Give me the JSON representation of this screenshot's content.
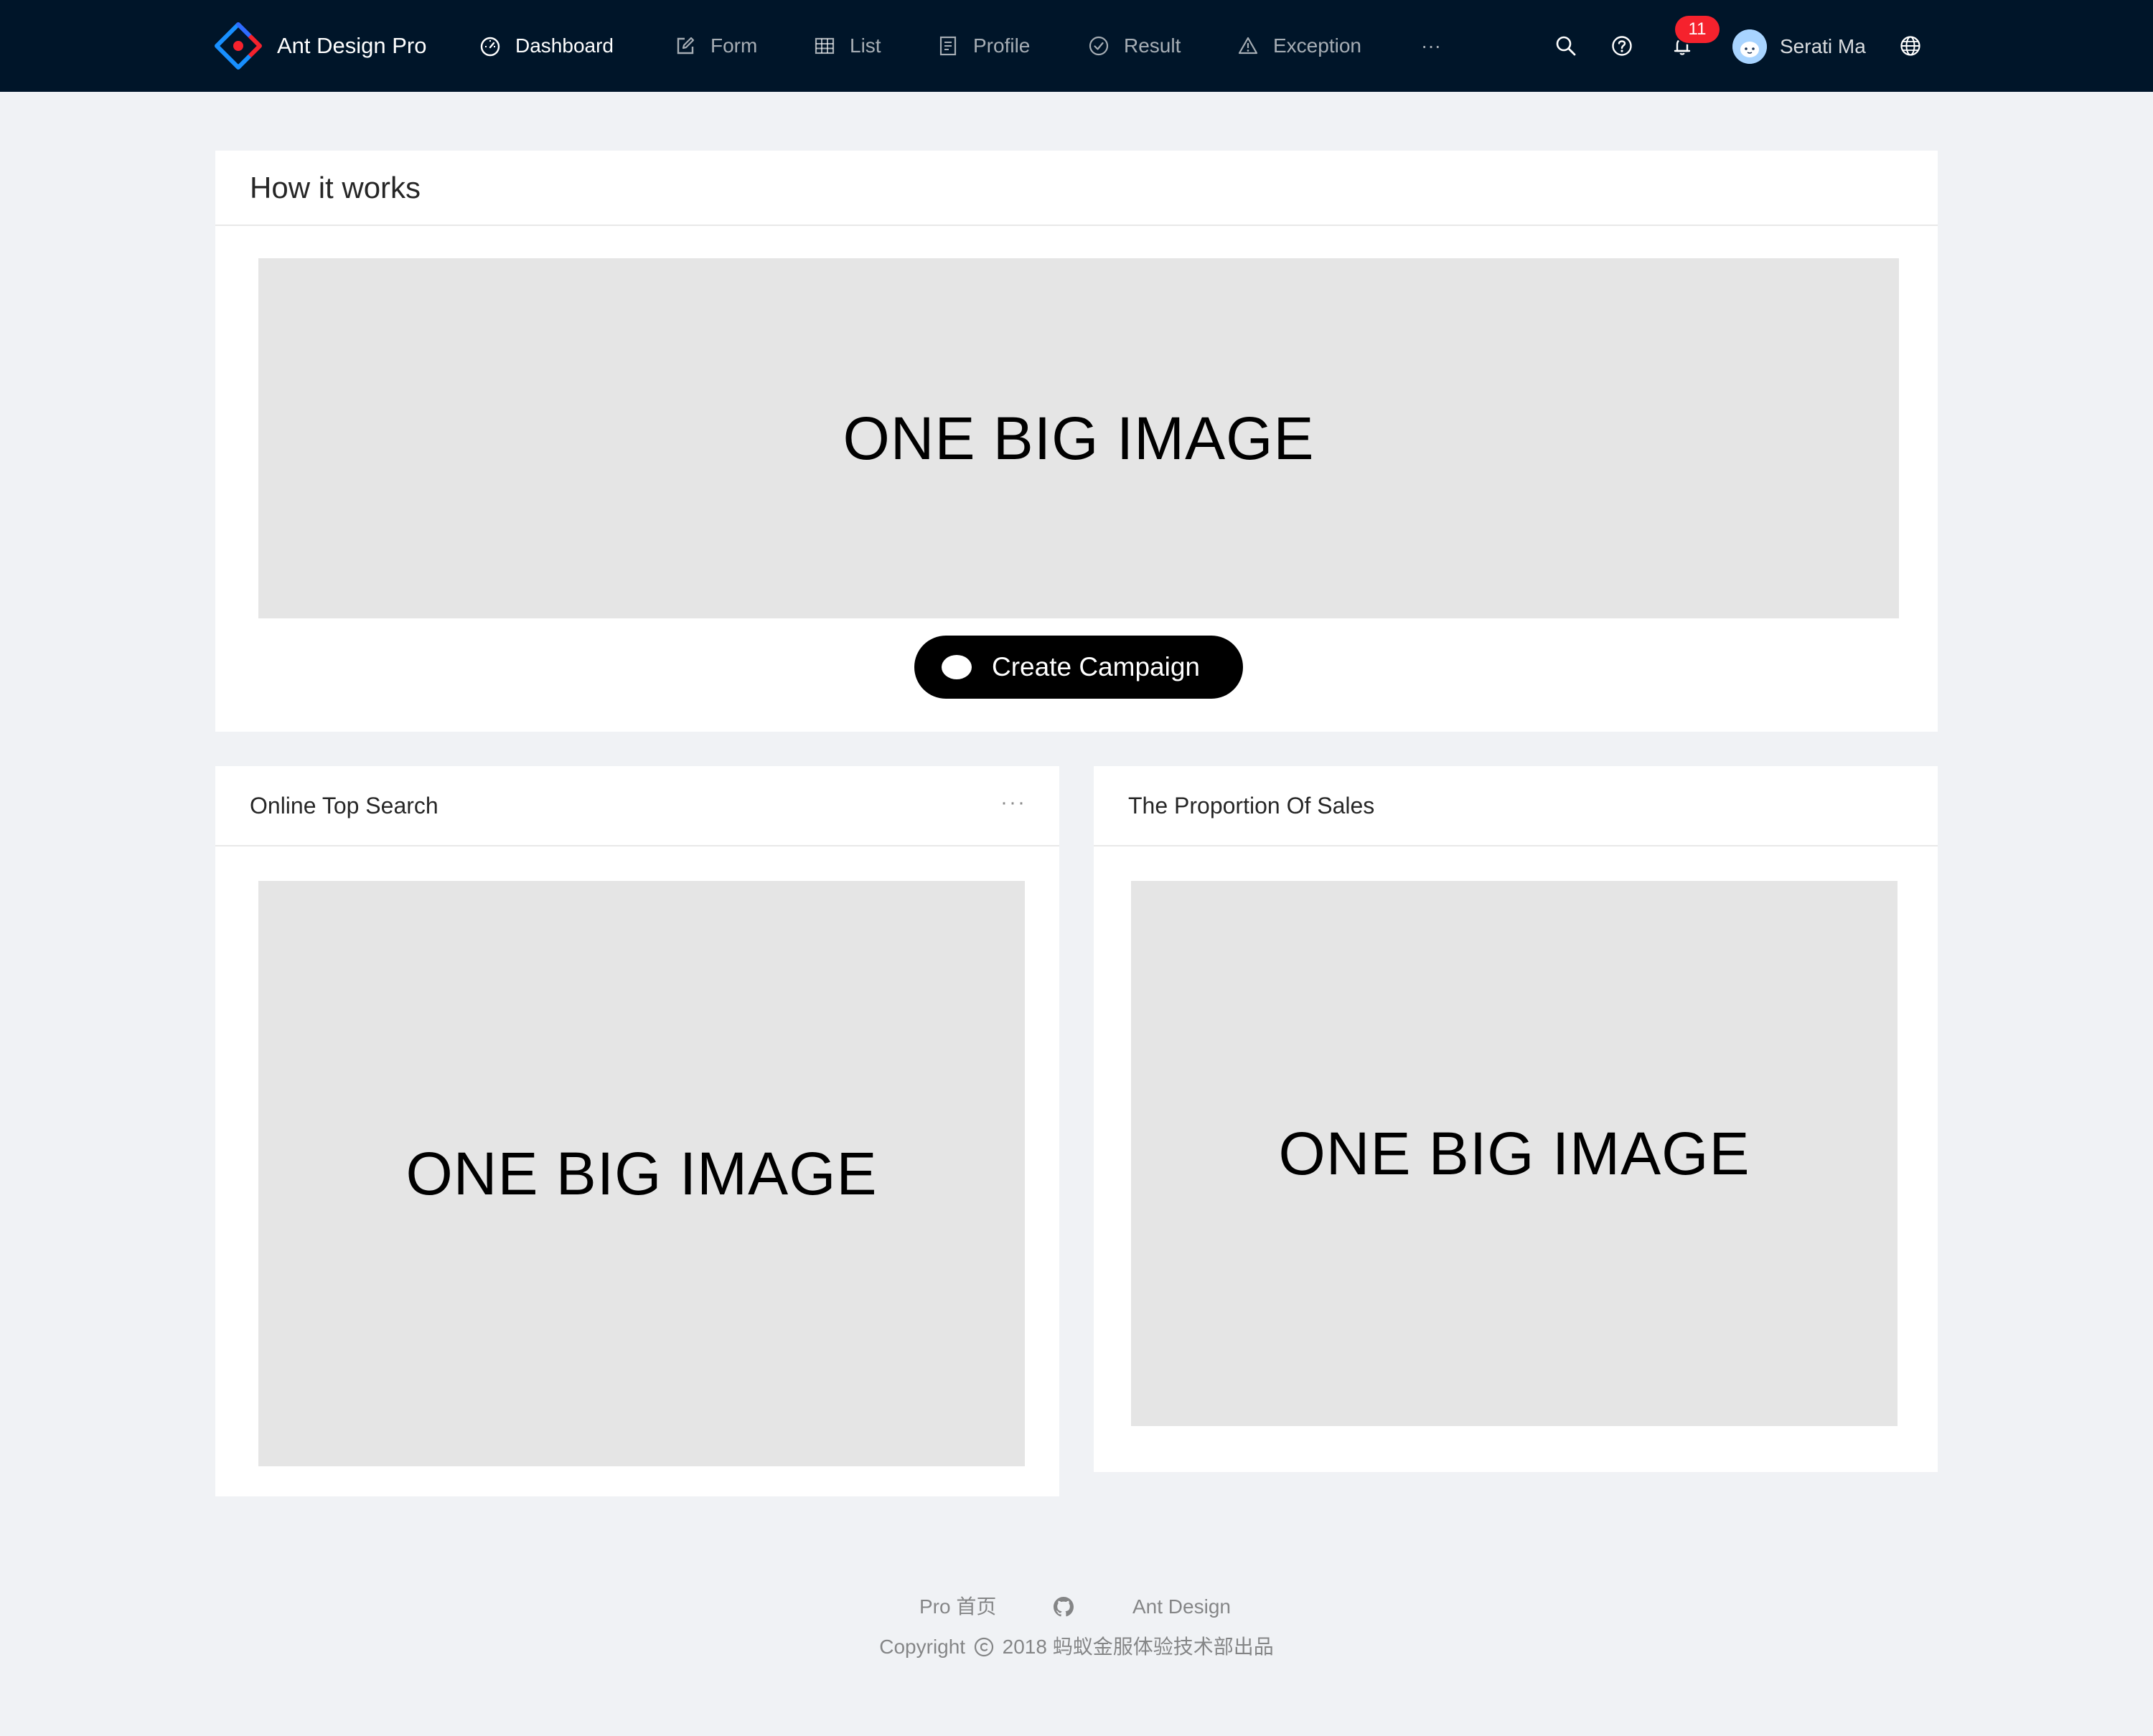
{
  "header": {
    "brand_name": "Ant Design Pro",
    "menu": [
      {
        "label": "Dashboard",
        "icon": "dashboard-icon",
        "active": true
      },
      {
        "label": "Form",
        "icon": "form-icon",
        "active": false
      },
      {
        "label": "List",
        "icon": "table-icon",
        "active": false
      },
      {
        "label": "Profile",
        "icon": "profile-icon",
        "active": false
      },
      {
        "label": "Result",
        "icon": "check-circle-icon",
        "active": false
      },
      {
        "label": "Exception",
        "icon": "warning-icon",
        "active": false
      },
      {
        "label": "···",
        "icon": "ellipsis-icon",
        "active": false
      }
    ],
    "notification_count": "11",
    "user_name": "Serati Ma",
    "colors": {
      "nav_bg": "#001529",
      "badge": "#f5222d",
      "page_bg": "#f0f2f5"
    }
  },
  "how_it_works": {
    "title": "How it works",
    "image_text": "ONE BIG IMAGE",
    "cta_label": "Create Campaign"
  },
  "top_search": {
    "title": "Online Top Search",
    "more": "···",
    "image_text": "ONE BIG IMAGE"
  },
  "sales": {
    "title": "The Proportion Of Sales",
    "image_text": "ONE BIG IMAGE"
  },
  "footer": {
    "links": [
      "Pro 首页",
      "Ant Design"
    ],
    "github_icon": "github-icon",
    "copyright_prefix": "Copyright",
    "copyright_suffix": "2018 蚂蚁金服体验技术部出品"
  }
}
